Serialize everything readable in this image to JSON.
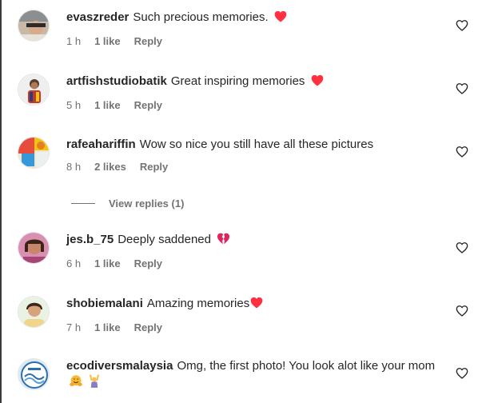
{
  "comments": [
    {
      "username": "evaszreder",
      "text": "Such precious memories.",
      "emoji": "red-heart",
      "time": "1 h",
      "likes": "1 like",
      "reply": "Reply"
    },
    {
      "username": "artfishstudiobatik",
      "text": "Great inspiring memories",
      "emoji": "red-heart",
      "time": "5 h",
      "likes": "1 like",
      "reply": "Reply"
    },
    {
      "username": "rafeahariffin",
      "text": "Wow so nice you still have all these pictures",
      "emoji": "",
      "time": "8 h",
      "likes": "2 likes",
      "reply": "Reply"
    },
    {
      "username": "jes.b_75",
      "text": "Deeply saddened",
      "emoji": "broken-heart",
      "time": "6 h",
      "likes": "1 like",
      "reply": "Reply"
    },
    {
      "username": "shobiemalani",
      "text": "Amazing memories",
      "emoji": "red-heart",
      "time": "7 h",
      "likes": "1 like",
      "reply": "Reply"
    },
    {
      "username": "ecodiversmalaysia",
      "text": "Omg, the first photo! You look alot like your mom",
      "emoji": "hugging-face, person-with-raised-hands",
      "time": "",
      "likes": "",
      "reply": ""
    }
  ],
  "view_replies": "View replies (1)",
  "colors": {
    "text": "#262626",
    "secondary": "#737373",
    "heart": "#ff3040"
  }
}
